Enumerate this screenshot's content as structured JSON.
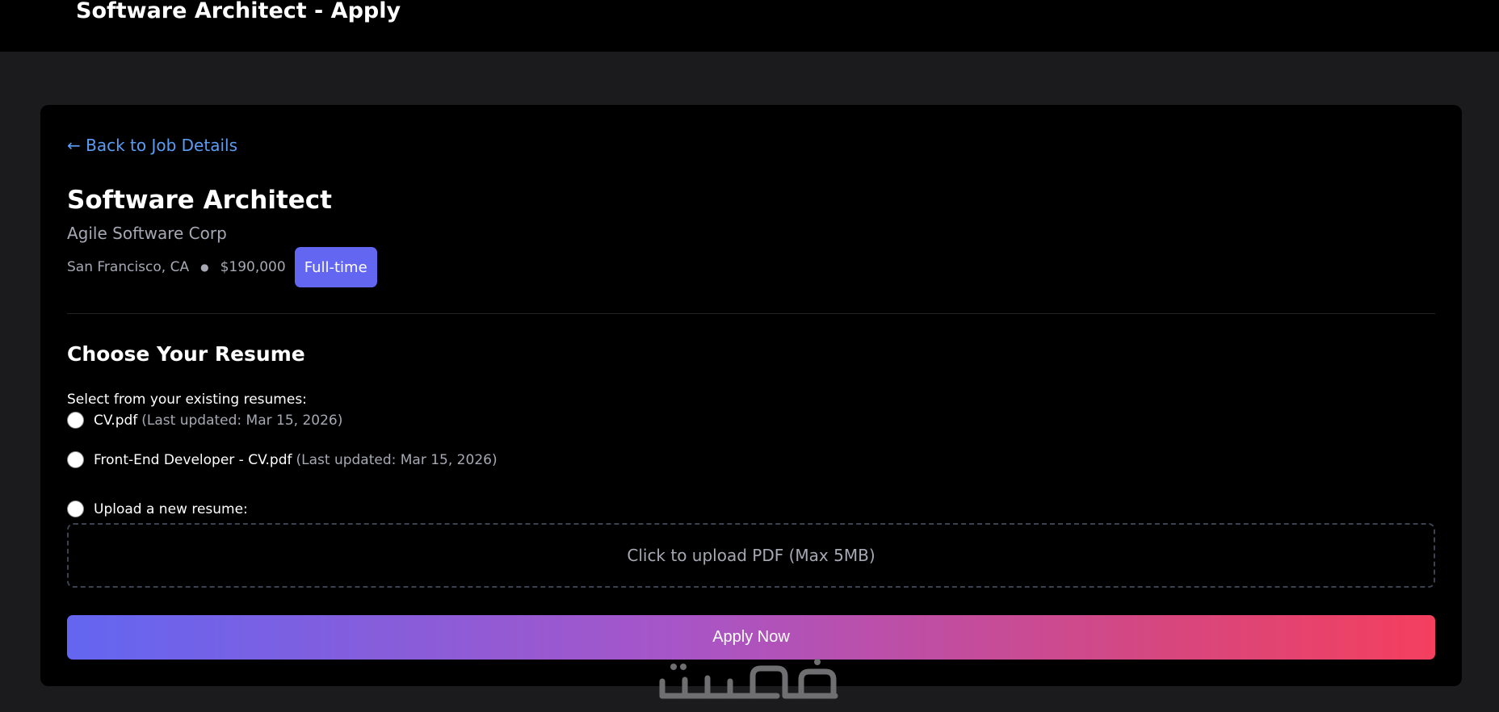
{
  "page": {
    "header_title": "Software Architect - Apply"
  },
  "nav": {
    "back_link": "← Back to Job Details"
  },
  "job": {
    "title": "Software Architect",
    "company": "Agile Software Corp",
    "location": "San Francisco, CA",
    "separator": "●",
    "salary": "$190,000",
    "type_badge": "Full-time"
  },
  "resume_section": {
    "title": "Choose Your Resume",
    "select_label": "Select from your existing resumes:",
    "resumes": [
      {
        "name": "CV.pdf",
        "meta": "(Last updated: Mar 15, 2026)",
        "selected": false
      },
      {
        "name": "Front-End Developer - CV.pdf",
        "meta": "(Last updated: Mar 15, 2026)",
        "selected": false
      }
    ],
    "upload_option_label": "Upload a new resume:",
    "upload_option_selected": false,
    "upload_box_text": "Click to upload PDF (Max 5MB)"
  },
  "actions": {
    "apply_label": "Apply Now"
  },
  "watermark": {
    "text": "خمسات",
    "color": "#6f6f72"
  },
  "colors": {
    "accent": "#6366f1",
    "link": "#5b9cf5",
    "gradient_start": "#6366f1",
    "gradient_end": "#f43f5e"
  }
}
